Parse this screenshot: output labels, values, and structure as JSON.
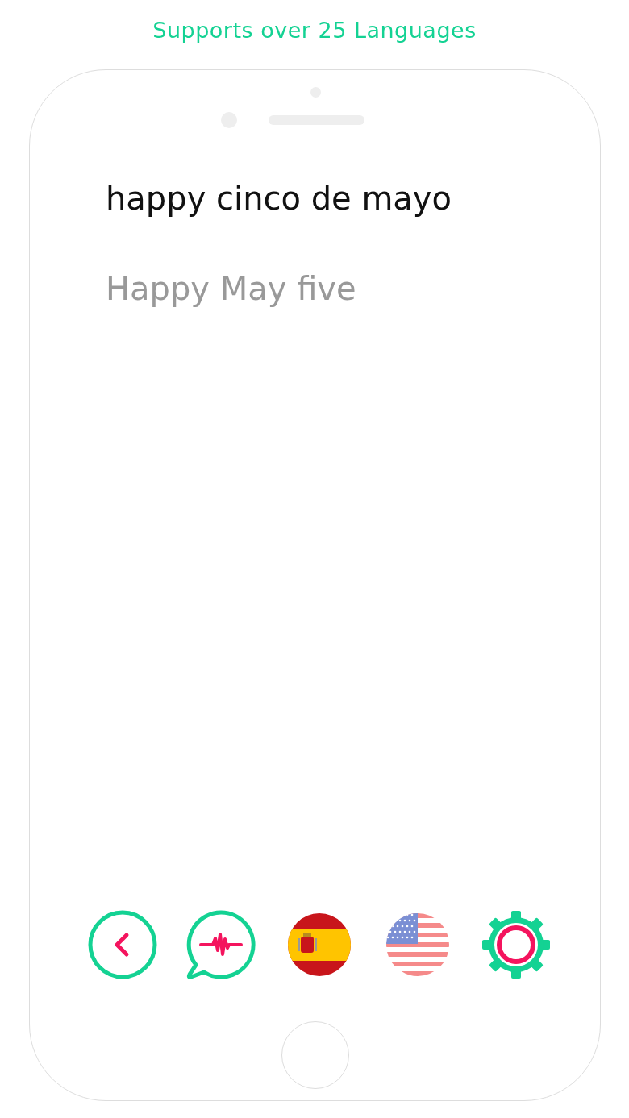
{
  "headline": "Supports over 25 Languages",
  "input_text": "happy cinco de mayo",
  "translation": "Happy May five",
  "toolbar": [
    {
      "kind": "back"
    },
    {
      "kind": "speak"
    },
    {
      "kind": "flag-spain"
    },
    {
      "kind": "flag-usa"
    },
    {
      "kind": "settings"
    }
  ]
}
